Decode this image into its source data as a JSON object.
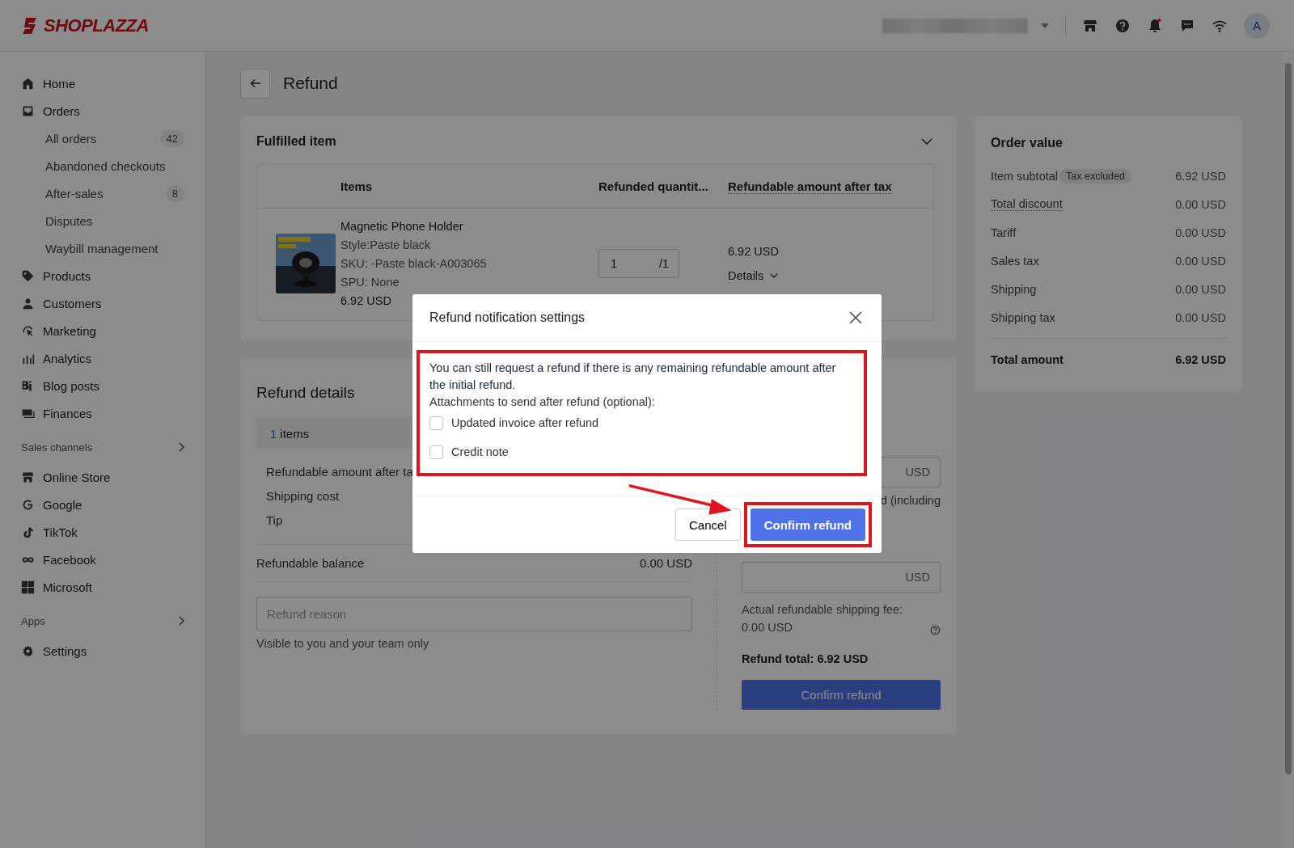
{
  "topbar": {
    "logo": "SHOPLAZZA",
    "avatar": "A"
  },
  "sidebar": {
    "groups": [
      {
        "items": [
          {
            "label": "Home"
          },
          {
            "label": "Orders",
            "children": [
              {
                "label": "All orders",
                "badge": "42"
              },
              {
                "label": "Abandoned checkouts"
              },
              {
                "label": "After-sales",
                "badge": "8"
              },
              {
                "label": "Disputes"
              },
              {
                "label": "Waybill management"
              }
            ]
          },
          {
            "label": "Products"
          },
          {
            "label": "Customers"
          },
          {
            "label": "Marketing"
          },
          {
            "label": "Analytics"
          },
          {
            "label": "Blog posts"
          },
          {
            "label": "Finances"
          }
        ]
      },
      {
        "heading": "Sales channels",
        "items": [
          {
            "label": "Online Store"
          },
          {
            "label": "Google"
          },
          {
            "label": "TikTok"
          },
          {
            "label": "Facebook"
          },
          {
            "label": "Microsoft"
          }
        ]
      },
      {
        "heading": "Apps"
      },
      {
        "items": [
          {
            "label": "Settings"
          }
        ]
      }
    ]
  },
  "page_title": "Refund",
  "fulfilled": {
    "title": "Fulfilled item",
    "columns": [
      {
        "label": "Items",
        "tooltip": false
      },
      {
        "label": "Refunded quantit...",
        "tooltip": false
      },
      {
        "label": "Refundable amount after tax",
        "tooltip": true
      }
    ],
    "item": {
      "name": "Magnetic Phone Holder",
      "style": "Style:Paste black",
      "sku": "SKU: -Paste black-A003065",
      "spu": "SPU: None",
      "price": "6.92 USD",
      "quantity": "1",
      "max": "/1",
      "amount": "6.92 USD",
      "details": "Details"
    }
  },
  "order_value": {
    "title": "Order value",
    "rows": [
      {
        "label": "Item subtotal",
        "badge": "Tax excluded",
        "value": "6.92 USD",
        "tooltip": false
      },
      {
        "label": "Total discount",
        "value": "0.00 USD",
        "tooltip": true
      },
      {
        "label": "Tariff",
        "value": "0.00 USD",
        "tooltip": false
      },
      {
        "label": "Sales tax",
        "value": "0.00 USD",
        "tooltip": false
      },
      {
        "label": "Shipping",
        "value": "0.00 USD",
        "tooltip": false
      },
      {
        "label": "Shipping tax",
        "value": "0.00 USD",
        "tooltip": false
      }
    ],
    "total": {
      "label": "Total amount",
      "value": "6.92 USD"
    }
  },
  "refund_details": {
    "title": "Refund details",
    "items_count": "1",
    "items_label": "items",
    "rows": [
      "Refundable amount after ta",
      "Shipping cost",
      "Tip"
    ],
    "balance_label": "Refundable balance",
    "balance_value": "0.00 USD",
    "reason_placeholder": "Refund reason",
    "reason_hint": "Visible to you and your team only",
    "amount_suffix": "USD",
    "amount_note": "d (including",
    "shipping_suffix": "USD",
    "shipping_note": "Actual refundable shipping fee: 0.00 USD",
    "total": "Refund total: 6.92 USD",
    "confirm": "Confirm refund"
  },
  "modal": {
    "title": "Refund notification settings",
    "message": "You can still request a refund if there is any remaining refundable amount after the initial refund.",
    "attachments_label": "Attachments to send after refund (optional):",
    "options": [
      {
        "label": "Updated invoice after refund",
        "checked": false
      },
      {
        "label": "Credit note",
        "checked": false
      }
    ],
    "cancel": "Cancel",
    "confirm": "Confirm refund"
  }
}
